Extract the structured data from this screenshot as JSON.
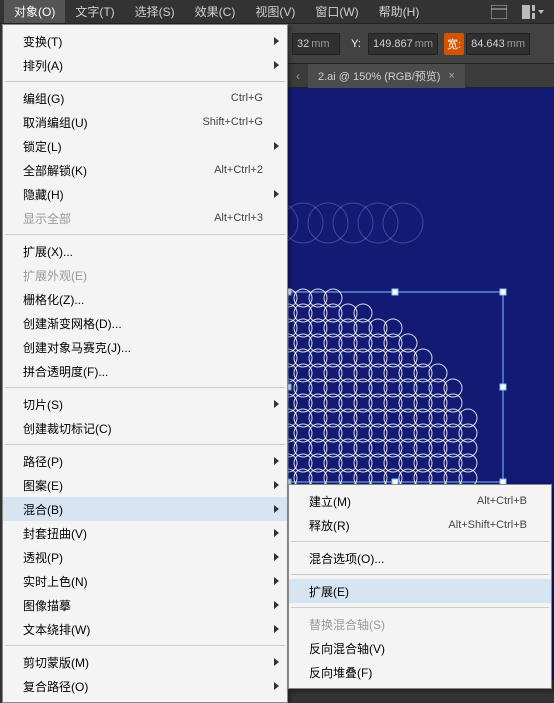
{
  "menubar": {
    "items": [
      {
        "label": "对象(O)",
        "active": true
      },
      {
        "label": "文字(T)"
      },
      {
        "label": "选择(S)"
      },
      {
        "label": "效果(C)"
      },
      {
        "label": "视图(V)"
      },
      {
        "label": "窗口(W)"
      },
      {
        "label": "帮助(H)"
      }
    ]
  },
  "options_bar": {
    "field1_suffix": "32",
    "unit": "mm",
    "y_label": "Y:",
    "y_value": "149.867",
    "w_label": "宽:",
    "w_value": "84.643"
  },
  "tab": {
    "prev_arrow": "‹",
    "title": "2.ai @ 150% (RGB/预览)",
    "close": "×"
  },
  "dropdown": {
    "groups": [
      [
        {
          "label": "变换(T)",
          "arrow": true
        },
        {
          "label": "排列(A)",
          "arrow": true
        }
      ],
      [
        {
          "label": "编组(G)",
          "shortcut": "Ctrl+G"
        },
        {
          "label": "取消编组(U)",
          "shortcut": "Shift+Ctrl+G"
        },
        {
          "label": "锁定(L)",
          "arrow": true
        },
        {
          "label": "全部解锁(K)",
          "shortcut": "Alt+Ctrl+2"
        },
        {
          "label": "隐藏(H)",
          "arrow": true
        },
        {
          "label": "显示全部",
          "shortcut": "Alt+Ctrl+3",
          "disabled": true
        }
      ],
      [
        {
          "label": "扩展(X)..."
        },
        {
          "label": "扩展外观(E)",
          "disabled": true
        },
        {
          "label": "栅格化(Z)..."
        },
        {
          "label": "创建渐变网格(D)..."
        },
        {
          "label": "创建对象马赛克(J)..."
        },
        {
          "label": "拼合透明度(F)..."
        }
      ],
      [
        {
          "label": "切片(S)",
          "arrow": true
        },
        {
          "label": "创建裁切标记(C)"
        }
      ],
      [
        {
          "label": "路径(P)",
          "arrow": true
        },
        {
          "label": "图案(E)",
          "arrow": true
        },
        {
          "label": "混合(B)",
          "arrow": true,
          "highlight": true
        },
        {
          "label": "封套扭曲(V)",
          "arrow": true
        },
        {
          "label": "透视(P)",
          "arrow": true
        },
        {
          "label": "实时上色(N)",
          "arrow": true
        },
        {
          "label": "图像描摹",
          "arrow": true
        },
        {
          "label": "文本绕排(W)",
          "arrow": true
        }
      ],
      [
        {
          "label": "剪切蒙版(M)",
          "arrow": true
        },
        {
          "label": "复合路径(O)",
          "arrow": true
        }
      ]
    ]
  },
  "submenu": {
    "groups": [
      [
        {
          "label": "建立(M)",
          "shortcut": "Alt+Ctrl+B"
        },
        {
          "label": "释放(R)",
          "shortcut": "Alt+Shift+Ctrl+B"
        }
      ],
      [
        {
          "label": "混合选项(O)..."
        }
      ],
      [
        {
          "label": "扩展(E)",
          "highlight": true
        }
      ],
      [
        {
          "label": "替换混合轴(S)",
          "disabled": true
        },
        {
          "label": "反向混合轴(V)"
        },
        {
          "label": "反向堆叠(F)"
        }
      ]
    ]
  }
}
